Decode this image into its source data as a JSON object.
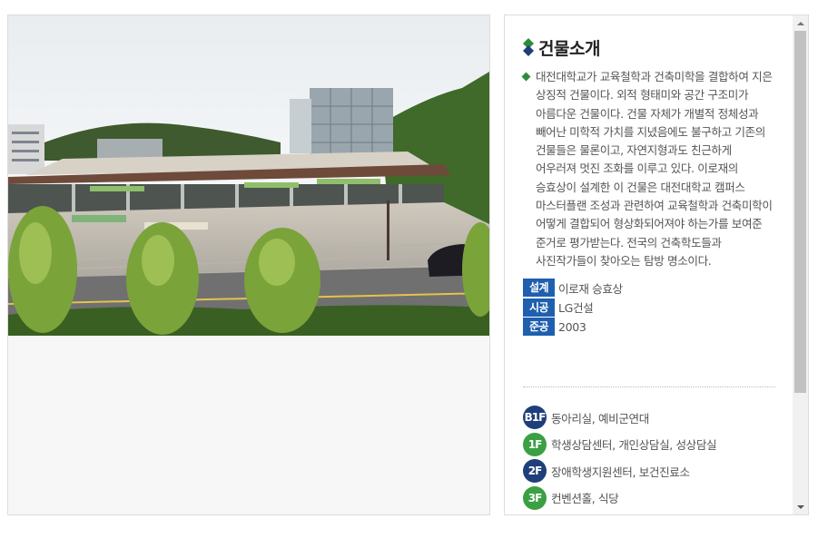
{
  "photo": {
    "alt_icon": "building-photo"
  },
  "info": {
    "title": "건물소개",
    "description": "대전대학교가 교육철학과 건축미학을 결합하여 지은 상징적 건물이다. 외적 형태미와 공간 구조미가 아름다운 건물이다. 건물 자체가 개별적 정체성과 빼어난 미학적 가치를 지녔음에도 불구하고 기존의 건물들은 물론이고, 자연지형과도 친근하게 어우러져 멋진 조화를 이루고 있다. 이로재의 승효상이 설계한 이 건물은 대전대학교 캠퍼스 마스터플랜 조성과 관련하여 교육철학과 건축미학이 어떻게 결합되어 형상화되어져야 하는가를 보여준 준거로 평가받는다. 전국의 건축학도들과 사진작가들이 찾아오는 탐방 명소이다.",
    "meta": [
      {
        "label": "설계",
        "value": "이로재 승효상"
      },
      {
        "label": "시공",
        "value": "LG건설"
      },
      {
        "label": "준공",
        "value": "2003"
      }
    ],
    "floors": [
      {
        "badge": "B1F",
        "text": "동아리실, 예비군연대",
        "color": "#1f3f7a"
      },
      {
        "badge": "1F",
        "text": "학생상담센터, 개인상담실, 성상담실",
        "color": "#3aa043"
      },
      {
        "badge": "2F",
        "text": "장애학생지원센터, 보건진료소",
        "color": "#1f3f7a"
      },
      {
        "badge": "3F",
        "text": "컨벤션홀, 식당",
        "color": "#3aa043"
      }
    ]
  },
  "colors": {
    "label_bg": "#1f5fae",
    "accent_green": "#2e8b3e",
    "accent_navy": "#1f3f7a"
  }
}
